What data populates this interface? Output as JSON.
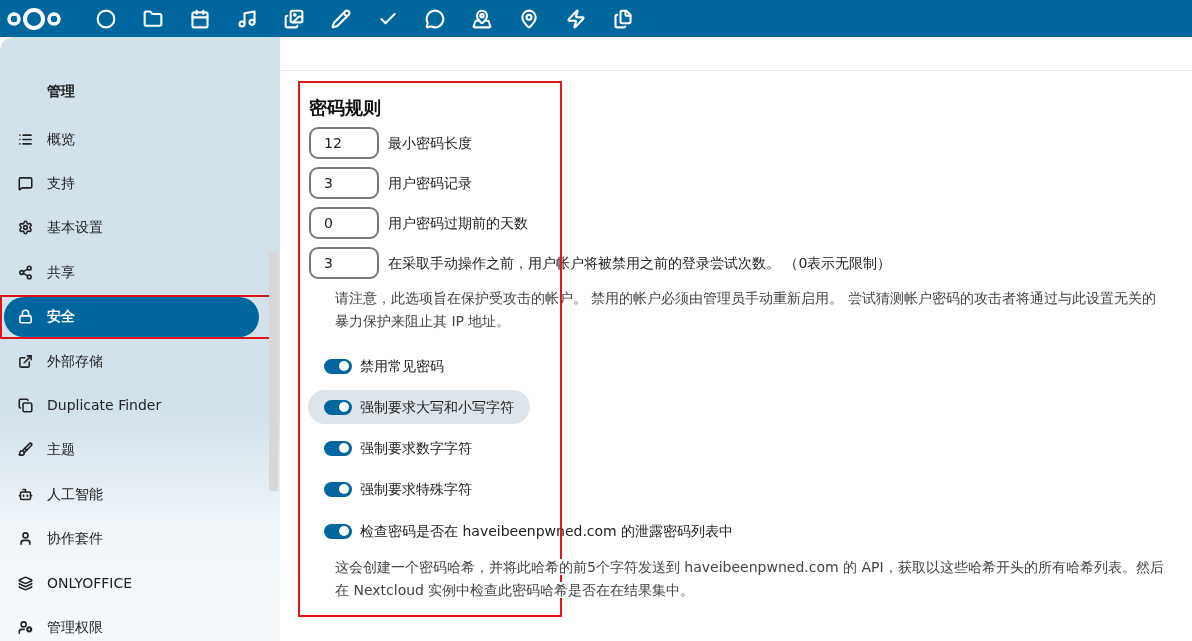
{
  "sidebar": {
    "heading": "管理",
    "items": [
      {
        "label": "概览",
        "selected": false,
        "highlighted": false
      },
      {
        "label": "支持",
        "selected": false,
        "highlighted": false
      },
      {
        "label": "基本设置",
        "selected": false,
        "highlighted": false
      },
      {
        "label": "共享",
        "selected": false,
        "highlighted": false
      },
      {
        "label": "安全",
        "selected": true,
        "highlighted": true
      },
      {
        "label": "外部存储",
        "selected": false,
        "highlighted": false
      },
      {
        "label": "Duplicate Finder",
        "selected": false,
        "highlighted": false
      },
      {
        "label": "主题",
        "selected": false,
        "highlighted": false
      },
      {
        "label": "人工智能",
        "selected": false,
        "highlighted": false
      },
      {
        "label": "协作套件",
        "selected": false,
        "highlighted": false
      },
      {
        "label": "ONLYOFFICE",
        "selected": false,
        "highlighted": false
      },
      {
        "label": "管理权限",
        "selected": false,
        "highlighted": false
      }
    ]
  },
  "section": {
    "title": "密码规则",
    "highlighted": true,
    "fields": [
      {
        "value": "12",
        "label": "最小密码长度"
      },
      {
        "value": "3",
        "label": "用户密码记录"
      },
      {
        "value": "0",
        "label": "用户密码过期前的天数"
      },
      {
        "value": "3",
        "label": "在采取手动操作之前，用户帐户将被禁用之前的登录尝试次数。 （0表示无限制）"
      }
    ],
    "field_note": "请注意，此选项旨在保护受攻击的帐户。 禁用的帐户必须由管理员手动重新启用。 尝试猜测帐户密码的攻击者将通过与此设置无关的暴力保护来阻止其 IP 地址。",
    "toggles": [
      {
        "label": "禁用常见密码",
        "on": true,
        "hovered": false
      },
      {
        "label": "强制要求大写和小写字符",
        "on": true,
        "hovered": true
      },
      {
        "label": "强制要求数字字符",
        "on": true,
        "hovered": false
      },
      {
        "label": "强制要求特殊字符",
        "on": true,
        "hovered": false
      },
      {
        "label": "检查密码是否在 haveibeenpwned.com 的泄露密码列表中",
        "on": true,
        "hovered": false
      }
    ],
    "toggle_note": "这会创建一个密码哈希，并将此哈希的前5个字符发送到 haveibeenpwned.com 的 API，获取以这些哈希开头的所有哈希列表。然后在 Nextcloud 实例中检查此密码哈希是否在在结果集中。"
  }
}
